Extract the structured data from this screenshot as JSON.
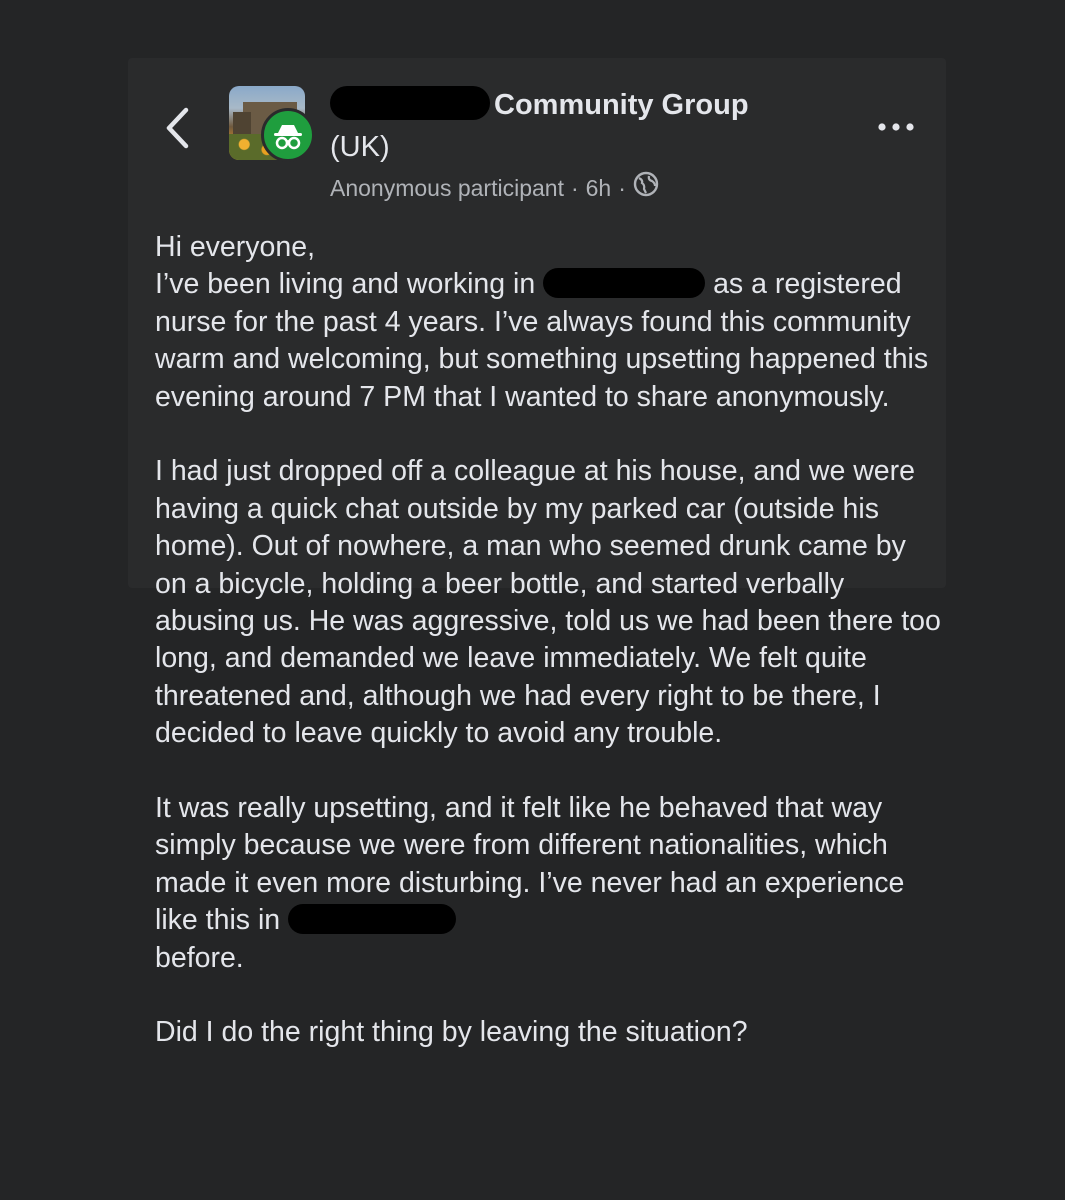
{
  "header": {
    "group_name": "Community Group",
    "group_name_suffix": "(UK)",
    "author": "Anonymous participant",
    "time": "6h",
    "separator": "·",
    "privacy_icon": "globe-icon",
    "back_icon": "chevron-left-icon",
    "more_icon": "more-horizontal-icon",
    "badge_icon": "anonymous-incognito-icon"
  },
  "post": {
    "line1": "Hi everyone,",
    "p1_start": "I’ve been living and working in",
    "p1_after_redact": "as a registered nurse for the past 4 years. I’ve always found this community warm and welcoming, but something upsetting happened this evening around 7 PM that I wanted to share anonymously.",
    "p2": "I had just dropped off a colleague at his house, and we were having a quick chat outside by my parked car (outside his home). Out of nowhere, a man who seemed drunk came by on a bicycle, holding a beer bottle, and started verbally abusing us. He was aggressive, told us we had been there too long, and demanded we leave immediately. We felt quite threatened and, although we had every right to be there, I decided to leave quickly to avoid any trouble.",
    "p3_start": "It was really upsetting, and it felt like he behaved that way simply because we were from different nationalities, which made it even more disturbing. I’ve never had an experience like this in",
    "p3_end": "before.",
    "p4": "Did I do the right thing by leaving the situation?"
  },
  "colors": {
    "background": "#242526",
    "text_primary": "#e4e6eb",
    "text_secondary": "#b0b3b8",
    "badge_green": "#1f9e3e",
    "redaction": "#000000"
  }
}
